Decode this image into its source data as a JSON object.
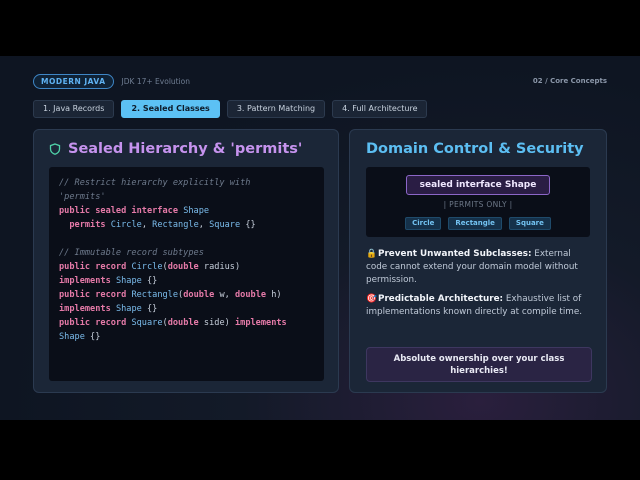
{
  "header": {
    "badge": "MODERN JAVA",
    "subtitle": "JDK 17+ Evolution",
    "crumb": "02 / Core Concepts"
  },
  "tabs": [
    {
      "label": "1. Java Records"
    },
    {
      "label": "2. Sealed Classes"
    },
    {
      "label": "3. Pattern Matching"
    },
    {
      "label": "4. Full Architecture"
    }
  ],
  "left_card": {
    "title": "Sealed Hierarchy & 'permits'",
    "icon": "shield-icon",
    "code": {
      "comment1a": "// Restrict hierarchy explicitly with",
      "comment1b": "'permits'",
      "l1_kw": "public sealed interface",
      "l1_ty": "Shape",
      "l2_kw": "permits",
      "l2_ty1": "Circle",
      "l2_ty2": "Rectangle",
      "l2_ty3": "Square",
      "comment2": "// Immutable record subtypes",
      "c_kw": "public record",
      "c_ty": "Circle",
      "c_p_kw": "double",
      "c_p": "radius",
      "impl_kw": "implements",
      "shape": "Shape",
      "r_ty": "Rectangle",
      "r_p1": "w",
      "r_p2": "h",
      "s_ty": "Square",
      "s_p": "side"
    }
  },
  "right_card": {
    "title": "Domain Control & Security",
    "diagram": {
      "interface": "sealed interface Shape",
      "permits": "| PERMITS ONLY |",
      "subtypes": [
        "Circle",
        "Rectangle",
        "Square"
      ]
    },
    "point1": {
      "icon": "lock-icon",
      "title": "Prevent Unwanted Subclasses:",
      "text": "External code cannot extend your domain model without permission."
    },
    "point2": {
      "icon": "target-icon",
      "title": "Predictable Architecture:",
      "text": "Exhaustive list of implementations known directly at compile time."
    },
    "callout": "Absolute ownership over your class hierarchies!"
  },
  "colors": {
    "accent_blue": "#5cc1f4",
    "accent_purple": "#c693ee",
    "keyword": "#e57aa8"
  }
}
